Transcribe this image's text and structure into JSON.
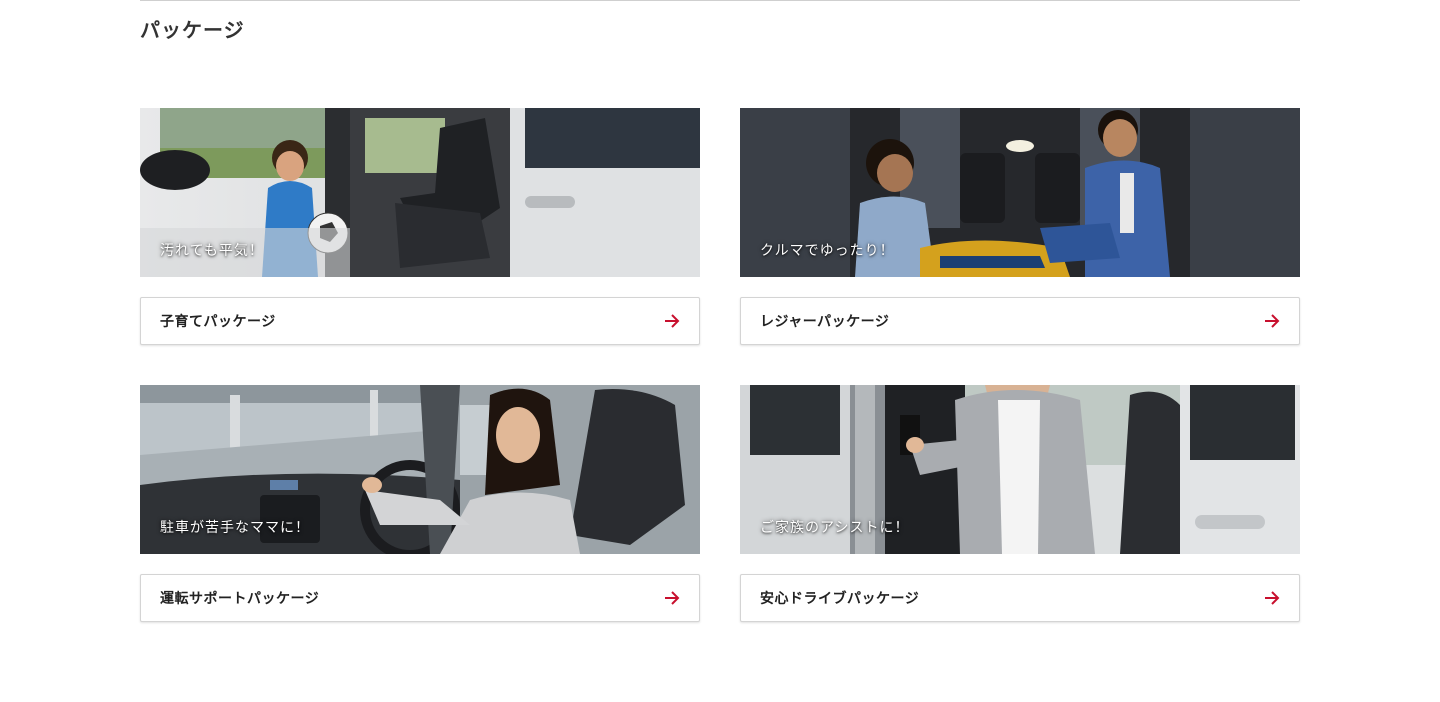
{
  "section": {
    "title": "パッケージ"
  },
  "cards": [
    {
      "caption": "汚れても平気！",
      "link_label": "子育てパッケージ"
    },
    {
      "caption": "クルマでゆったり！",
      "link_label": "レジャーパッケージ"
    },
    {
      "caption": "駐車が苦手なママに！",
      "link_label": "運転サポートパッケージ"
    },
    {
      "caption": "ご家族のアシストに！",
      "link_label": "安心ドライブパッケージ"
    }
  ],
  "colors": {
    "accent": "#c8102e",
    "border": "#d4d4d4",
    "title_text": "#333333"
  },
  "icons": {
    "link_arrow": "arrow-right-icon"
  }
}
